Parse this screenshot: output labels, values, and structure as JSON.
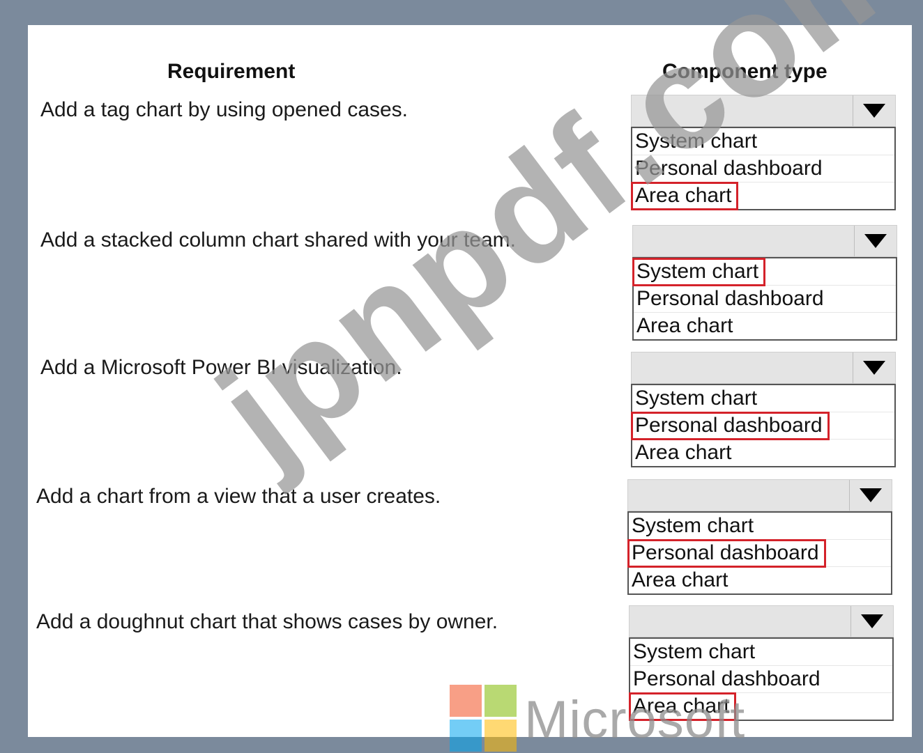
{
  "headers": {
    "requirement": "Requirement",
    "component_type": "Component type"
  },
  "rows": [
    {
      "requirement": "Add a tag chart by using opened cases.",
      "options": [
        "System chart",
        "Personal dashboard",
        "Area chart"
      ],
      "selected": "Area chart"
    },
    {
      "requirement": "Add a stacked column chart shared with your team.",
      "options": [
        "System chart",
        "Personal dashboard",
        "Area chart"
      ],
      "selected": "System chart"
    },
    {
      "requirement": "Add a Microsoft Power BI visualization.",
      "options": [
        "System chart",
        "Personal dashboard",
        "Area chart"
      ],
      "selected": "Personal dashboard"
    },
    {
      "requirement": "Add a chart from a view that a user creates.",
      "options": [
        "System chart",
        "Personal dashboard",
        "Area chart"
      ],
      "selected": "Personal dashboard"
    },
    {
      "requirement": "Add a doughnut chart that shows cases by owner.",
      "options": [
        "System chart",
        "Personal dashboard",
        "Area chart"
      ],
      "selected": "Area chart"
    }
  ],
  "watermark": "jpnpdf.com",
  "logo": {
    "word": "Microsoft",
    "colors": [
      "#f25022",
      "#7fba00",
      "#00a4ef",
      "#ffb900"
    ]
  },
  "highlight_color": "#d4222a"
}
